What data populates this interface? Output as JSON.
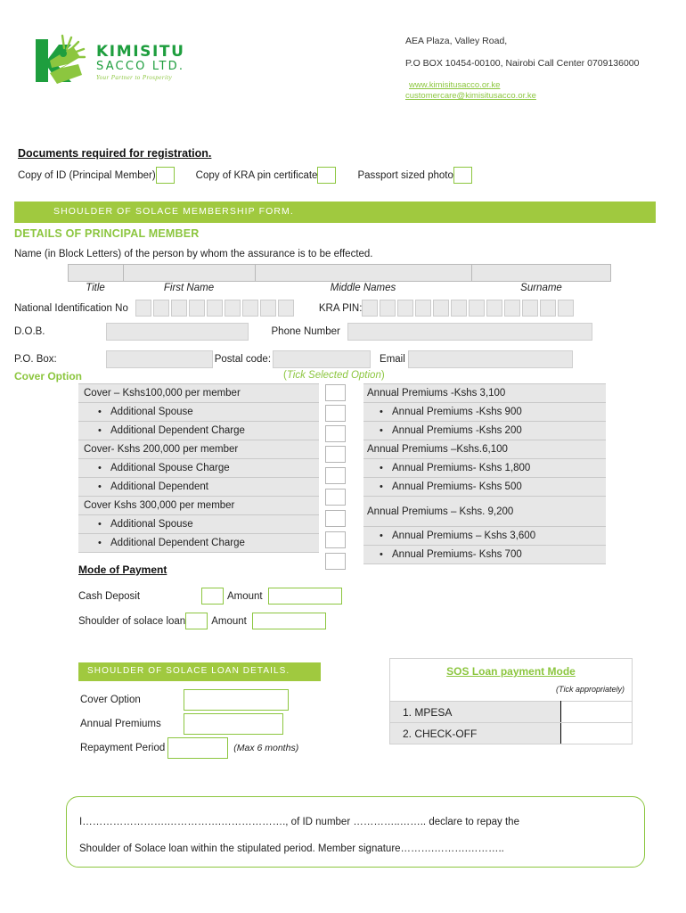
{
  "header": {
    "logo": {
      "name": "KIMISITU",
      "sub": "SACCO LTD.",
      "tagline": "Your Partner to Prosperity"
    },
    "address_line1": "AEA Plaza, Valley Road,",
    "address_line2": "P.O BOX  10454-00100, Nairobi Call Center 0709136000",
    "website": "www.kimisitusacco.or.ke",
    "email": "customercare@kimisitusacco.or.ke"
  },
  "documents": {
    "title": "Documents required for registration.",
    "items": [
      {
        "label": "Copy of ID (Principal Member)"
      },
      {
        "label": "Copy of KRA pin certificate"
      },
      {
        "label": "Passport sized photo"
      }
    ]
  },
  "banner": {
    "text": "SHOULDER OF SOLACE MEMBERSHIP FORM."
  },
  "principal": {
    "section_title": "DETAILS OF PRINCIPAL MEMBER",
    "assurance_note": "Name (in Block Letters) of the person by whom the assurance is to be effected.",
    "name_labels": [
      "Title",
      "First Name",
      "Middle Names",
      "Surname"
    ],
    "national_id_label": "National Identification No",
    "national_id_boxes": 9,
    "kra_pin_label": "KRA PIN:",
    "kra_pin_boxes": 12,
    "dob_label": "D.O.B.",
    "phone_label": "Phone Number",
    "pobox_label": "P.O. Box:",
    "postal_label": "Postal code:",
    "email_label": "Email"
  },
  "cover": {
    "option_label": "Cover Option",
    "tick_note_prefix": "(",
    "tick_note": "Tick Selected Option",
    "tick_note_suffix": ")",
    "rows": [
      {
        "label": "Cover – Kshs100,000 per member",
        "bulleted": false
      },
      {
        "label": "Additional Spouse",
        "bulleted": true
      },
      {
        "label": "Additional Dependent Charge",
        "bulleted": true
      },
      {
        "label": "Cover- Kshs 200,000 per member",
        "bulleted": false
      },
      {
        "label": "Additional Spouse Charge",
        "bulleted": true
      },
      {
        "label": "Additional Dependent",
        "bulleted": true
      },
      {
        "label": "Cover Kshs 300,000 per member",
        "bulleted": false
      },
      {
        "label": "Additional Spouse",
        "bulleted": true
      },
      {
        "label": "Additional Dependent Charge",
        "bulleted": true
      }
    ],
    "premiums": [
      {
        "label": "Annual Premiums -Kshs 3,100",
        "bulleted": false,
        "tall": false
      },
      {
        "label": "Annual Premiums -Kshs 900",
        "bulleted": true,
        "tall": false
      },
      {
        "label": "Annual Premiums -Kshs 200",
        "bulleted": true,
        "tall": false
      },
      {
        "label": "Annual Premiums –Kshs.6,100",
        "bulleted": false,
        "tall": false
      },
      {
        "label": "Annual Premiums- Kshs 1,800",
        "bulleted": true,
        "tall": false
      },
      {
        "label": "Annual Premiums- Kshs 500",
        "bulleted": true,
        "tall": false
      },
      {
        "label": "Annual Premiums – Kshs. 9,200",
        "bulleted": false,
        "tall": true
      },
      {
        "label": "Annual Premiums – Kshs 3,600",
        "bulleted": true,
        "tall": false
      },
      {
        "label": "Annual Premiums- Kshs 700",
        "bulleted": true,
        "tall": false
      }
    ]
  },
  "payment": {
    "title": "Mode of Payment",
    "cash_label": "Cash Deposit",
    "cash_amount_label": "Amount",
    "loan_label": "Shoulder of solace loan",
    "loan_amount_label": "Amount"
  },
  "sos_loan": {
    "banner": "SHOULDER OF SOLACE LOAN DETAILS.",
    "cover_option_label": "Cover Option",
    "annual_premiums_label": "Annual Premiums",
    "repayment_label": "Repayment Period",
    "max_note": "(Max 6 months)"
  },
  "sos_payment_mode": {
    "title": "SOS Loan payment Mode",
    "tick_note": "(Tick appropriately)",
    "rows": [
      {
        "num": "1.",
        "label": "MPESA"
      },
      {
        "num": "2.",
        "label": "CHECK-OFF"
      }
    ]
  },
  "declaration": {
    "line1": "I…………………….…………….………………., of ID number …………..…….. declare to repay the",
    "line2": "Shoulder of Solace loan within the stipulated period. Member signature……….……….……….."
  },
  "colors": {
    "brand_green": "#8cc63f",
    "banner_green": "#a0c93f",
    "dark_green": "#1e9e3e",
    "field_gray": "#e7e7e7"
  }
}
